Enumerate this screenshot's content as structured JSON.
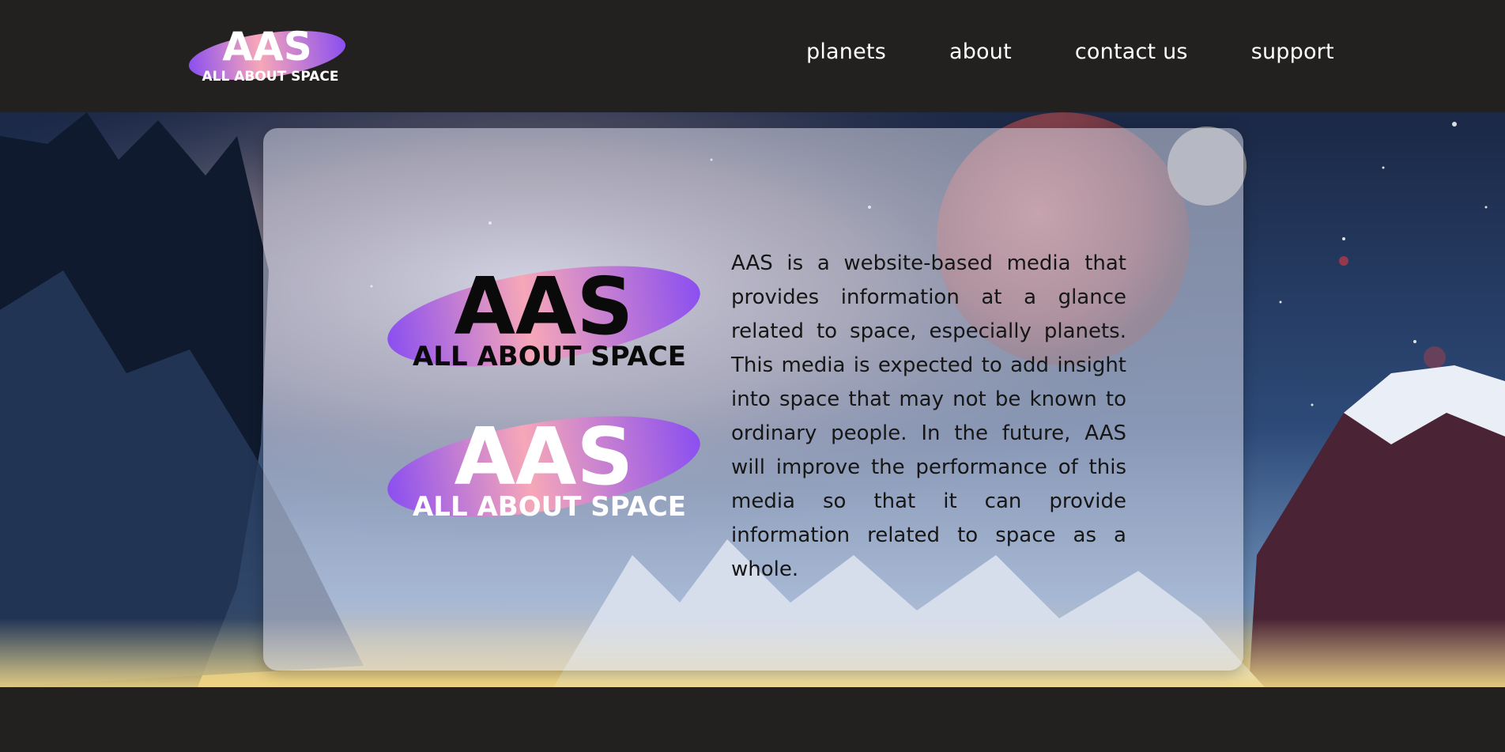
{
  "nav": {
    "logo": {
      "main": "AAS",
      "tagline": "ALL ABOUT SPACE",
      "icon": "planet-ring-logo"
    },
    "links": [
      "planets",
      "about",
      "contact us",
      "support"
    ]
  },
  "hero": {
    "logos": [
      {
        "main": "AAS",
        "tagline": "ALL ABOUT SPACE",
        "variant": "dark"
      },
      {
        "main": "AAS",
        "tagline": "ALL ABOUT SPACE",
        "variant": "light"
      }
    ],
    "description": "AAS is a website-based media that provides information at a glance related to space, especially planets. This media is expected to add insight into space that may not be known to ordinary people. In the future, AAS will improve the performance of this media so that it can provide information related to space as a whole."
  },
  "colors": {
    "header_bg": "#222120",
    "brand_purple": "#8b4ff0",
    "brand_pink": "#f6a7b8",
    "card_bg": "rgba(220,222,238,0.52)"
  }
}
